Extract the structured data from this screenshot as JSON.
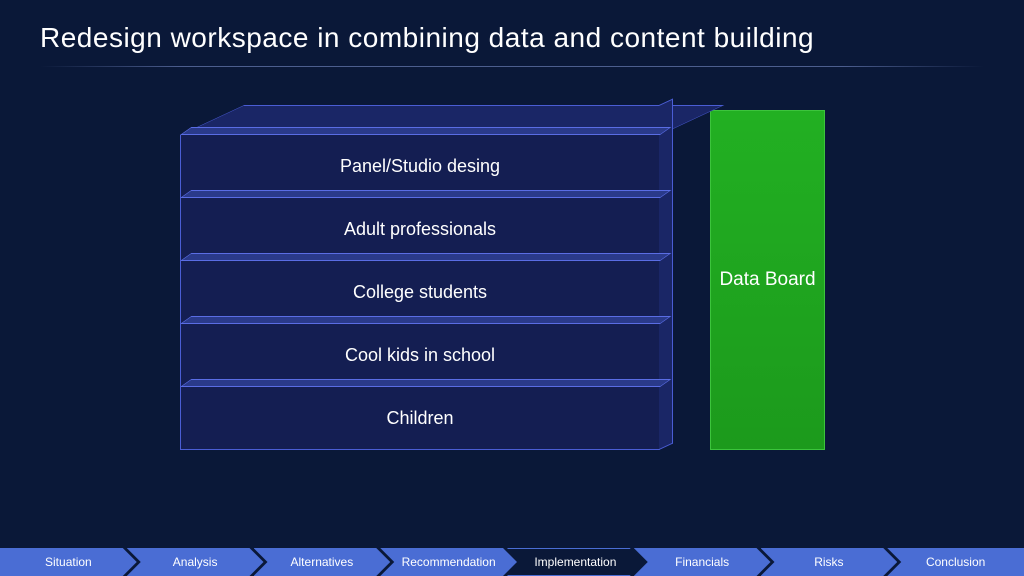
{
  "title": "Redesign workspace in combining data and content building",
  "layers": [
    "Panel/Studio desing",
    "Adult professionals",
    "College students",
    "Cool kids in school",
    "Children"
  ],
  "side_box": "Data Board",
  "breadcrumb": {
    "items": [
      "Situation",
      "Analysis",
      "Alternatives",
      "Recommendation",
      "Implementation",
      "Financials",
      "Risks",
      "Conclusion"
    ],
    "active_index": 4
  }
}
